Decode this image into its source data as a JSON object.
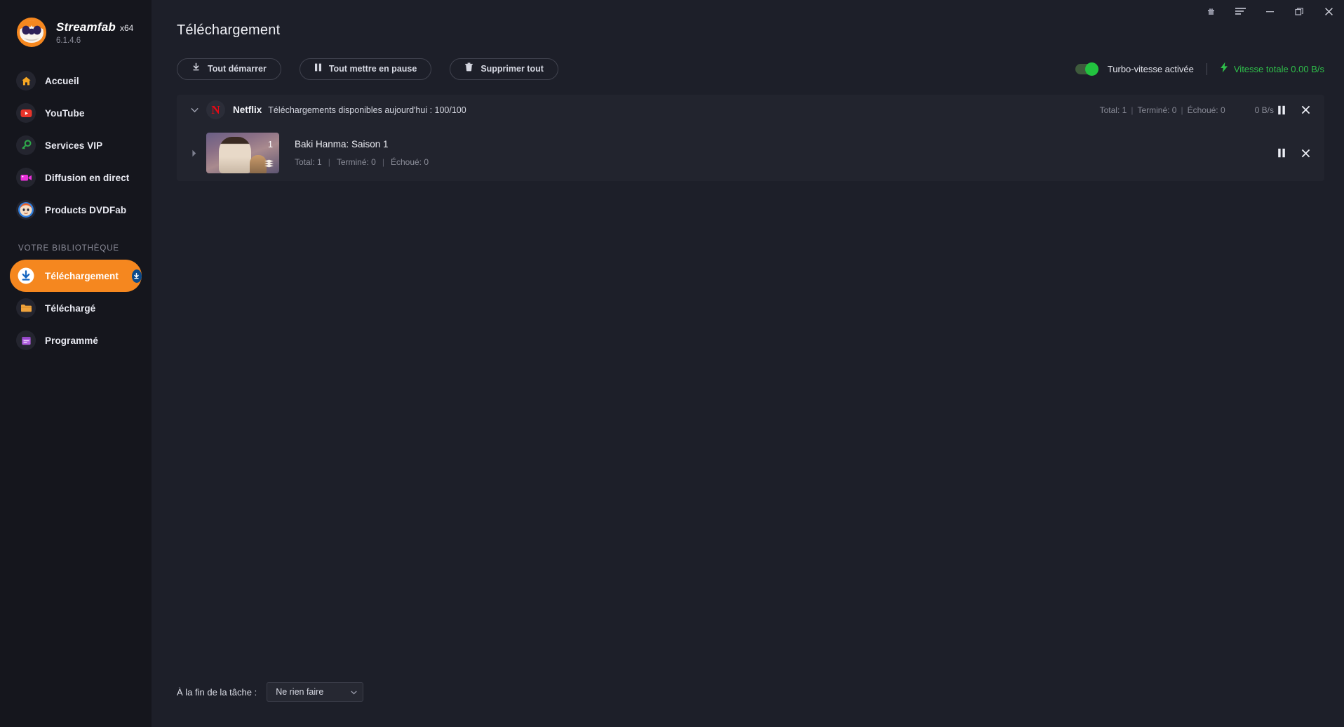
{
  "window": {
    "controls": [
      {
        "name": "gift-icon",
        "label": ""
      },
      {
        "name": "menu-icon",
        "label": ""
      },
      {
        "name": "minimize-icon",
        "label": ""
      },
      {
        "name": "restore-icon",
        "label": ""
      },
      {
        "name": "close-icon",
        "label": ""
      }
    ]
  },
  "brand": {
    "name": "Streamfab",
    "arch": "x64",
    "version": "6.1.4.6",
    "logo_icon": "streamfab-logo-icon"
  },
  "sidebar": {
    "items": [
      {
        "label": "Accueil",
        "icon": "home-icon",
        "icon_color": "#f5a623",
        "active": false
      },
      {
        "label": "YouTube",
        "icon": "youtube-icon",
        "icon_color": "#e8342a",
        "active": false
      },
      {
        "label": "Services VIP",
        "icon": "key-icon",
        "icon_color": "#2ea84a",
        "active": false
      },
      {
        "label": "Diffusion en direct",
        "icon": "video-camera-icon",
        "icon_color": "#e831d8",
        "active": false
      },
      {
        "label": "Products DVDFab",
        "icon": "dvdfab-mascot-icon",
        "icon_color": "#2f7fe0",
        "active": false
      }
    ],
    "section_label": "VOTRE BIBLIOTHÈQUE",
    "library_items": [
      {
        "label": "Téléchargement",
        "icon": "download-circle-icon",
        "icon_color": "#ffffff",
        "active": true,
        "badge_icon": "download-badge-icon"
      },
      {
        "label": "Téléchargé",
        "icon": "folder-icon",
        "icon_color": "#f0a33c",
        "active": false
      },
      {
        "label": "Programmé",
        "icon": "calendar-icon",
        "icon_color": "#b060e0",
        "active": false
      }
    ],
    "active_color": "#f5871f"
  },
  "header": {
    "title": "Téléchargement"
  },
  "toolbar": {
    "start_all_label": "Tout démarrer",
    "start_all_icon": "download-arrow-icon",
    "pause_all_label": "Tout mettre en pause",
    "pause_all_icon": "pause-icon",
    "delete_all_label": "Supprimer tout",
    "delete_all_icon": "trash-icon",
    "turbo_label": "Turbo-vitesse activée",
    "turbo_enabled": true,
    "turbo_color": "#22c23f",
    "speed_icon": "lightning-bolt-icon",
    "speed_label": "Vitesse totale 0.00 B/s",
    "speed_color": "#2fbf4a"
  },
  "groups": [
    {
      "caret_icon": "chevron-down-icon",
      "logo_icon": "netflix-logo-icon",
      "logo_letter": "N",
      "name": "Netflix",
      "subtitle": "Téléchargements disponibles aujourd'hui : 100/100",
      "stats": [
        {
          "label": "Total: 1"
        },
        {
          "label": "Terminé: 0"
        },
        {
          "label": "Échoué: 0"
        }
      ],
      "speed": "0 B/s",
      "pause_icon": "pause-icon",
      "close_icon": "close-icon",
      "tasks": [
        {
          "caret_icon": "chevron-right-icon",
          "thumbnail_icon": "baki-hanma-thumbnail",
          "episode_count": "1",
          "stack_icon": "stacked-layers-icon",
          "title": "Baki Hanma: Saison 1",
          "stats": [
            {
              "label": "Total: 1"
            },
            {
              "label": "Terminé: 0"
            },
            {
              "label": "Échoué: 0"
            }
          ],
          "pause_icon": "pause-icon",
          "close_icon": "close-icon"
        }
      ]
    }
  ],
  "footer": {
    "label": "À la fin de la tâche :",
    "select_value": "Ne rien faire",
    "select_arrow_icon": "chevron-down-icon"
  }
}
